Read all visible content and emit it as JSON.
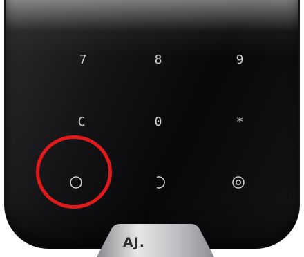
{
  "keypad": {
    "rows": [
      [
        "7",
        "8",
        "9"
      ],
      [
        "C",
        "0",
        "*"
      ]
    ],
    "mode_buttons": [
      {
        "icon": "disarm-circle-icon"
      },
      {
        "icon": "arm-partial-arc-icon"
      },
      {
        "icon": "night-mode-target-icon"
      }
    ]
  },
  "brand": {
    "logo_text": "AJ."
  },
  "highlight": {
    "color": "#e01a1a",
    "target": "disarm-circle-icon"
  }
}
